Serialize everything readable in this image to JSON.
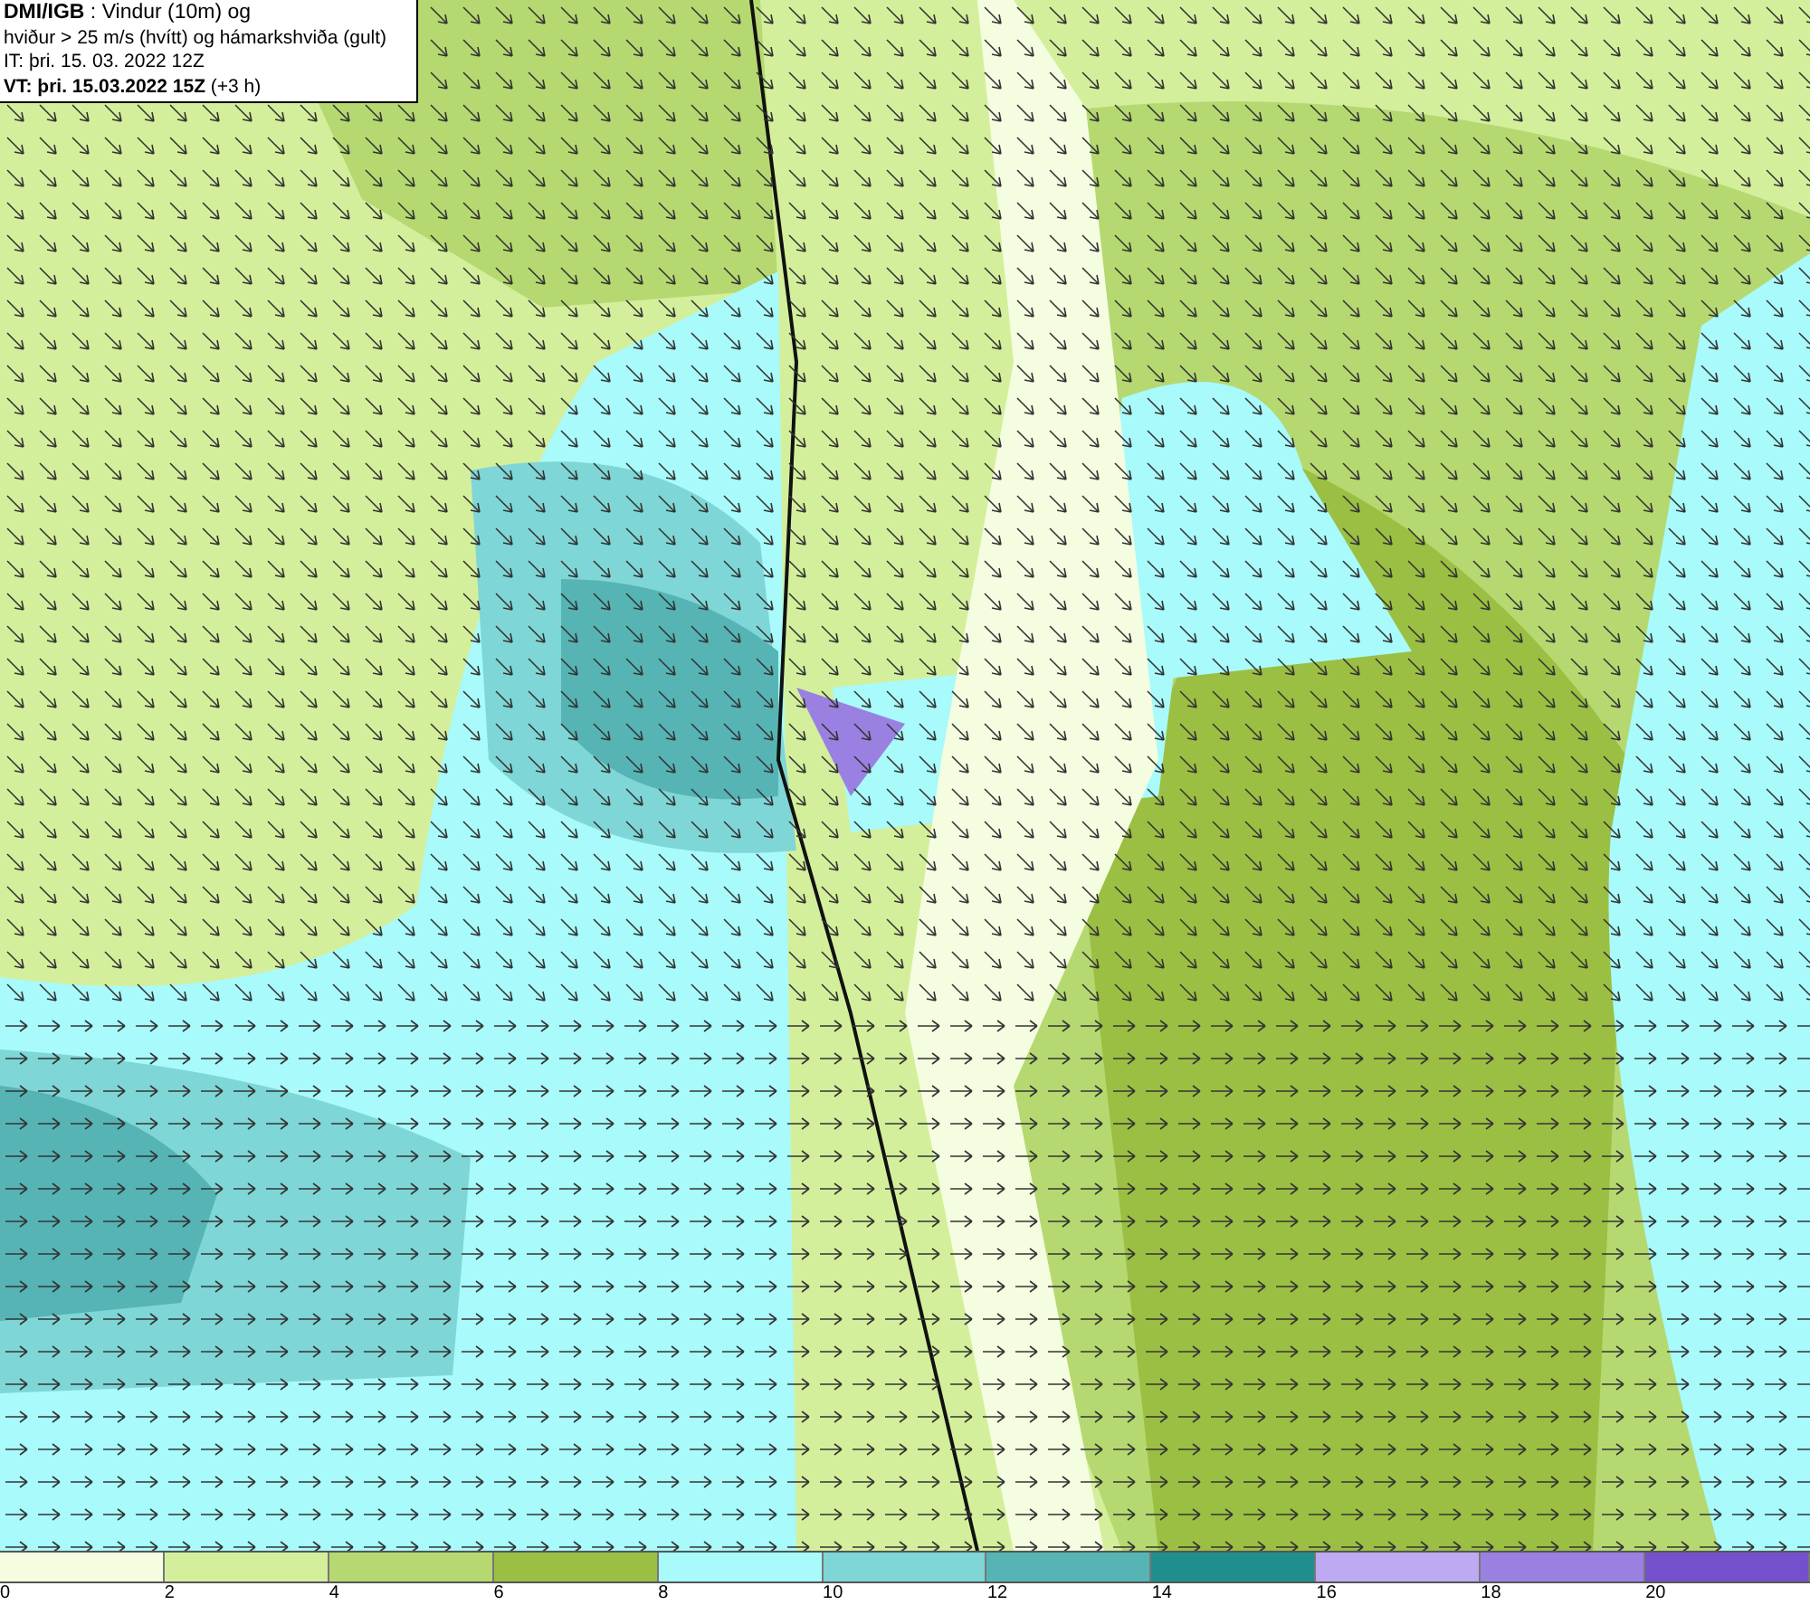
{
  "header": {
    "lines": [
      "**DMI/IGB** : Vindur (10m) og",
      "hviður > 25 m/s (hvítt) og hámarkshviða (gult)",
      "IT: þri. 15. 03. 2022 12Z",
      "**VT: þri. 15.03.2022 15Z** (+3 h)"
    ]
  },
  "legend": {
    "bins": [
      {
        "color": "#f4fde0"
      },
      {
        "color": "#d4ef9b"
      },
      {
        "color": "#b5d970"
      },
      {
        "color": "#9bbf42"
      },
      {
        "color": "#a8fafb"
      },
      {
        "color": "#7fd6d6"
      },
      {
        "color": "#56b4b4"
      },
      {
        "color": "#218e8e"
      },
      {
        "color": "#bdaaf3"
      },
      {
        "color": "#9a80e0"
      },
      {
        "color": "#7550cc"
      }
    ],
    "labels": [
      "0",
      "2",
      "4",
      "6",
      "8",
      "10",
      "12",
      "14",
      "16",
      "18",
      "20"
    ]
  }
}
